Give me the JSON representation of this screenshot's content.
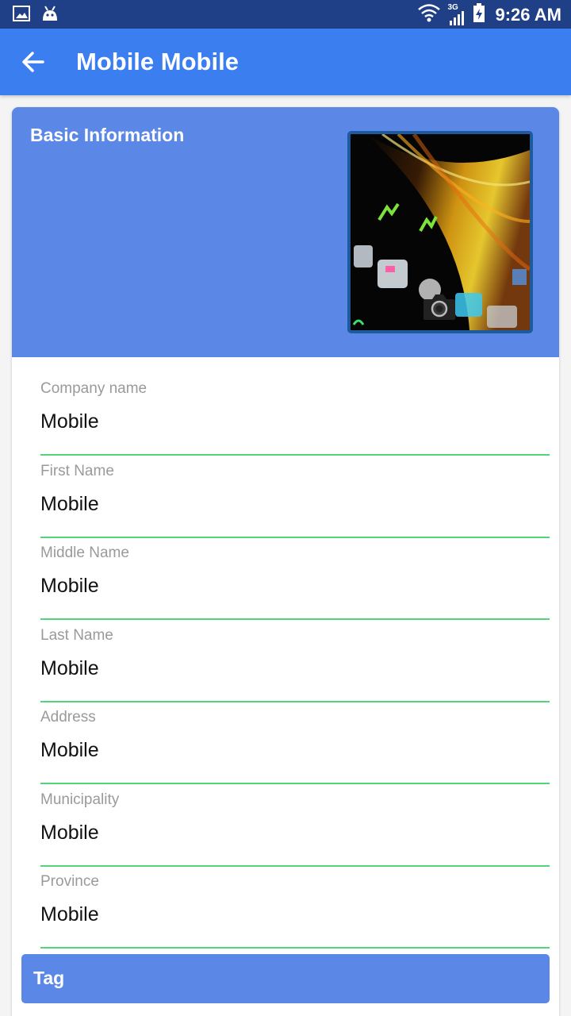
{
  "status_bar": {
    "time": "9:26 AM",
    "network_label": "3G",
    "icons": [
      "gallery-icon",
      "android-icon",
      "wifi-icon",
      "cell-signal-icon",
      "battery-icon"
    ]
  },
  "app_bar": {
    "title": "Mobile Mobile",
    "back_icon": "arrow-left-icon"
  },
  "section": {
    "title": "Basic Information"
  },
  "photo": {
    "camera_icon": "camera-icon"
  },
  "fields": [
    {
      "label": "Company name",
      "value": "Mobile"
    },
    {
      "label": "First Name",
      "value": "Mobile"
    },
    {
      "label": "Middle Name",
      "value": "Mobile"
    },
    {
      "label": "Last Name",
      "value": "Mobile"
    },
    {
      "label": "Address",
      "value": "Mobile"
    },
    {
      "label": "Municipality",
      "value": "Mobile"
    },
    {
      "label": "Province",
      "value": "Mobile"
    }
  ],
  "tag": {
    "label": "Tag"
  },
  "colors": {
    "status_bar": "#1f3f86",
    "app_bar": "#3b7ef0",
    "section_header": "#5b87e6",
    "field_underline": "#53d37a"
  }
}
